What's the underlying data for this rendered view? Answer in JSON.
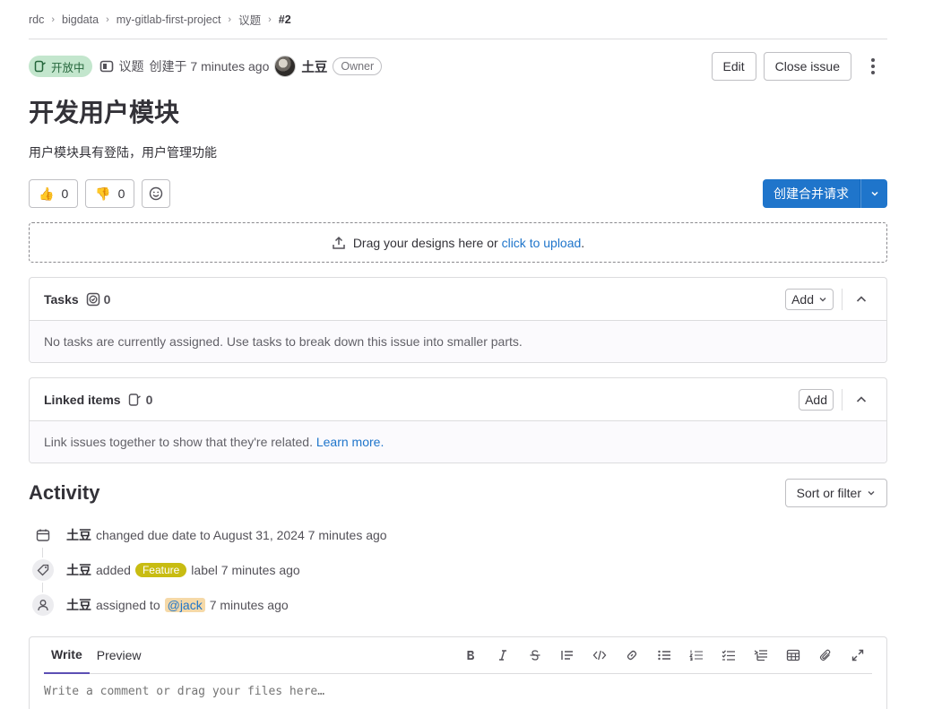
{
  "breadcrumb": [
    "rdc",
    "bigdata",
    "my-gitlab-first-project",
    "议题",
    "#2"
  ],
  "issue": {
    "status": "开放中",
    "type": "议题",
    "created": "创建于 7 minutes ago",
    "author": "土豆",
    "role": "Owner",
    "title": "开发用户模块",
    "description": "用户模块具有登陆，用户管理功能"
  },
  "actions": {
    "edit": "Edit",
    "close": "Close issue"
  },
  "awards": {
    "thumbsup": "0",
    "thumbsdown": "0"
  },
  "merge_request_button": "创建合并请求",
  "upload": {
    "text": "Drag your designs here or",
    "link": "click to upload",
    "tail": "."
  },
  "tasks": {
    "title": "Tasks",
    "count": "0",
    "add": "Add",
    "empty": "No tasks are currently assigned. Use tasks to break down this issue into smaller parts."
  },
  "linked": {
    "title": "Linked items",
    "count": "0",
    "add": "Add",
    "empty": "Link issues together to show that they're related.",
    "learn": "Learn more."
  },
  "activity": {
    "title": "Activity",
    "sort": "Sort or filter",
    "items": [
      {
        "icon": "calendar-icon",
        "who": "土豆",
        "text": "changed due date to August 31, 2024 7 minutes ago"
      },
      {
        "icon": "label-icon",
        "who": "土豆",
        "pre": "added",
        "label": "Feature",
        "post": "label 7 minutes ago"
      },
      {
        "icon": "user-icon",
        "who": "土豆",
        "pre": "assigned to",
        "mention": "@jack",
        "post": "7 minutes ago"
      }
    ]
  },
  "editor": {
    "tab_write": "Write",
    "tab_preview": "Preview",
    "placeholder": "Write a comment or drag your files here…"
  },
  "colors": {
    "open_badge": "#c3e6cd",
    "primary": "#1f75cb",
    "label_feature": "#c8bc12"
  }
}
